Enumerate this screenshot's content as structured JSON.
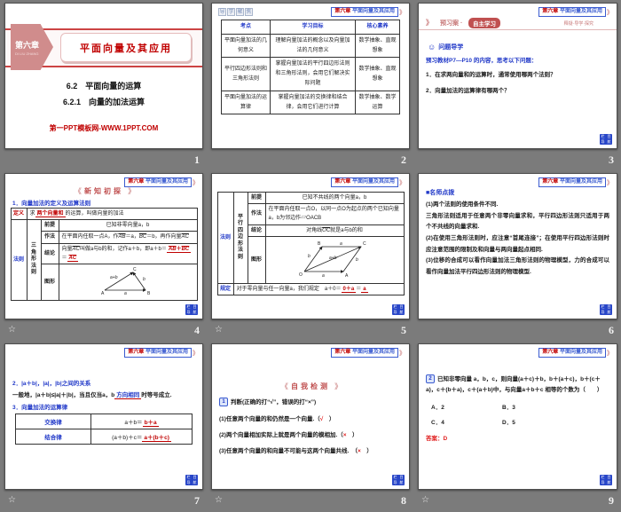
{
  "sorter": {
    "numbers": [
      "1",
      "2",
      "3",
      "4",
      "5",
      "6",
      "7",
      "8",
      "9"
    ],
    "star_icon": "☆"
  },
  "shared": {
    "chapter_badge": {
      "chapter": "第六章",
      "title": "平面向量及其应用",
      "chevrons": "》"
    },
    "nav_badge": {
      "c1": "栏",
      "c2": "目",
      "c3": "导",
      "c4": "航"
    }
  },
  "slide1": {
    "chapter": "第六章",
    "chapter_pinyin": "DI LIU ZHANG",
    "title": "平面向量及其应用",
    "subtitle1": "6.2　平面向量的运算",
    "subtitle2": "6.2.1　向量的加法运算",
    "footer": "第一PPT模板网-WWW.1PPT.COM"
  },
  "slide2": {
    "corner_tag": [
      "导",
      "学",
      "聚",
      "焦"
    ],
    "table": {
      "headers": [
        "考点",
        "学习目标",
        "核心素养"
      ],
      "rows": [
        [
          "平面向量加法的几何意义",
          "理解向量加法的概念以及向量加法的几何意义",
          "数学抽象、直观想象"
        ],
        [
          "平行四边形法则和三角形法则",
          "掌握向量加法的平行四边形法则和三角形法则，会用它们解决实际问题",
          "数学抽象、直观想象"
        ],
        [
          "平面向量加法的运算律",
          "掌握向量加法的交换律和结合律，会用它们进行计算",
          "数学抽象、数学运算"
        ]
      ]
    }
  },
  "slide3": {
    "header": {
      "chevron": "》",
      "left": "预习案 ·",
      "pill": "自主学习",
      "right": "释疑·导学·探究"
    },
    "icon_title": "问题导学",
    "smiley": "☺",
    "lead": "预习教材P7—P10 的内容，思考以下问题：",
    "q1": "1．在求两向量和的运算时，通常使用哪两个法则？",
    "q2": "2．向量加法的运算律有哪两个？"
  },
  "slide4": {
    "section": {
      "deco_l": "《",
      "text": "新知初探",
      "deco_r": "》"
    },
    "heading": "1．向量加法的定义及运算法则",
    "def_label": "定义",
    "def_pre": "求",
    "def_blank": "两个向量和",
    "def_post": "的运算，叫做向量的加法",
    "rule_label": "法则",
    "method_name": "三角形法则",
    "premise_label": "前提",
    "premise": "已知非零向量a，b",
    "draw_label": "作法",
    "draw": {
      "p1": "在平面内任取一点A，作",
      "v1": "AB",
      "p2": "＝a，",
      "v2": "BC",
      "p3": "＝b，再作向量",
      "v3": "AC"
    },
    "concl_label": "结论",
    "concl": {
      "p1": "向量",
      "v1": "AC",
      "p2": "叫做a与b的和，记作a＋b，即a＋b＝",
      "b1a": "AB",
      "plus": "＋",
      "b1b": "BC",
      "eq": "＝",
      "b2": "AC"
    },
    "fig_label": "图形",
    "figure": {
      "A": "A",
      "B": "B",
      "C": "C",
      "a": "a",
      "b": "b",
      "sum": "a+b"
    }
  },
  "slide5": {
    "rule_label": "法则",
    "method_name": "平行四边形法则",
    "premise_label": "前提",
    "premise": "已知不共线的两个向量a，b",
    "draw_label": "作法",
    "draw": "在平面内任取一点O，以同一点O为起点的两个已知向量a，b为邻边作▱OACB",
    "concl_label": "结论",
    "concl": {
      "p1": "对角线",
      "v1": "OC",
      "p2": "就是a与b的和"
    },
    "fig_label": "图形",
    "figure": {
      "O": "O",
      "A": "A",
      "B": "B",
      "C": "C",
      "a": "a",
      "b": "b",
      "sum": "a+b"
    },
    "rule2_label": "规定",
    "rule2": {
      "p1": "对于零向量与任一向量a，我们规定　a＋0＝",
      "b1": "0＋a",
      "eq": "＝",
      "b2": "a"
    }
  },
  "slide6": {
    "heading": "■名师点拨",
    "lines": [
      "(1)两个法则的使用条件不同.",
      "三角形法则适用于任意两个非零向量求和，平行四边形法则只适用于两个不共线的向量求和.",
      "(2)在使用三角形法则时，应注意“首尾连接”；在使用平行四边形法则时应注意范围的限制及和向量与两向量起点相同.",
      "(3)位移的合成可以看作向量加法三角形法则的物理模型，力的合成可以看作向量加法平行四边形法则的物理模型."
    ]
  },
  "slide7": {
    "h2": "2．|a＋b|，|a|，|b|之间的关系",
    "sent": {
      "pre": "一般地，|a＋b|≤|a|＋|b|，当且仅当a，b",
      "blank": "方向相同",
      "post": "时等号成立."
    },
    "h3": "3．向量加法的运算律",
    "table": {
      "r1_label": "交换律",
      "r1_pre": "a＋b＝",
      "r1_blank": "b＋a",
      "r2_label": "结合律",
      "r2_pre": "(a＋b)＋c＝",
      "r2_blank": "a＋(b＋c)"
    }
  },
  "slide8": {
    "section": {
      "deco_l": "《",
      "text": "自我检测",
      "deco_r": "》"
    },
    "qnum": "1",
    "lead": "判断(正确的打“√”，错误的打“×”)",
    "items": [
      {
        "pre": "(1)任意两个向量的和仍然是一个向量.（",
        "mark": "√",
        "post": "　）"
      },
      {
        "pre": "(2)两个向量相加实际上就是两个向量的模相加.（",
        "mark": "×",
        "post": "　）"
      },
      {
        "pre": "(3)任意两个向量的和向量不可能与这两个向量共线.　（",
        "mark": "×",
        "post": "　）"
      }
    ]
  },
  "slide9": {
    "qnum": "2",
    "stem": "已知非零向量 a，b，c，则向量(a＋c)＋b，b＋(a＋c)，b＋(c＋a)，c＋(b＋a)，c＋(a＋b)中，与向量a＋b＋c 相等的个数为（　　）",
    "options": [
      "A．2",
      "B．3",
      "C．4",
      "D．5"
    ],
    "answer_label": "答案：",
    "answer": "D"
  }
}
